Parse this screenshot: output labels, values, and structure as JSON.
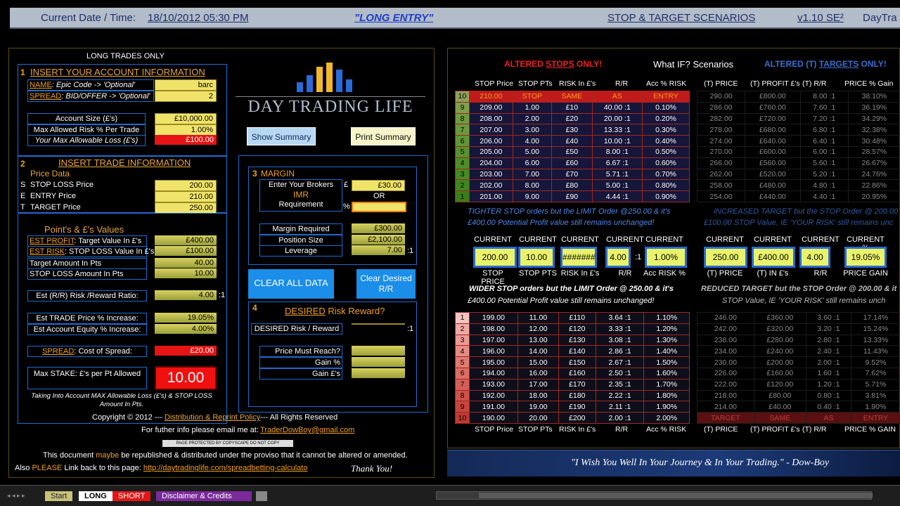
{
  "topbar": {
    "datetime_label": "Current Date / Time:",
    "datetime": "18/10/2012   05:30 PM",
    "mode": "\"LONG ENTRY\"",
    "scenarios": "STOP & TARGET SCENARIOS",
    "version": "v1.10 SE²",
    "brand": "DayTra"
  },
  "left": {
    "long_only": "LONG TRADES ONLY",
    "s1": {
      "num": "1",
      "title": "INSERT YOUR ACCOUNT INFORMATION",
      "name_label": "NAME",
      "name_hint": ": Epic Code -> 'Optional'",
      "name_val": "barc",
      "spread_label": "SPREAD",
      "spread_hint": ": BID/OFFER -> 'Optional'",
      "spread_val": "2",
      "acc_label": "Account Size (£'s)",
      "acc_val": "£10,000.00",
      "risk_label": "Max Allowed Risk % Per Trade",
      "risk_val": "1.00%",
      "loss_label": "Your Max Allowable Loss (£'s)",
      "loss_val": "£100.00"
    },
    "s2": {
      "num": "2",
      "title": "INSERT TRADE INFORMATION",
      "price_data": "Price Data",
      "s": "S",
      "e": "E",
      "t": "T",
      "stop_label": "STOP LOSS Price",
      "stop_val": "200.00",
      "entry_label": "ENTRY Price",
      "entry_val": "210.00",
      "target_label": "TARGET  Price",
      "target_val": "250.00"
    },
    "pv": {
      "title": "Point's & £'s Values",
      "profit_label": "EST PROFIT",
      "profit_hint": ": Target Value In £'s",
      "profit_val": "£400.00",
      "risk_label": "EST RISK",
      "risk_hint": ": STOP LOSS Value In £'s",
      "risk_val": "£100.00",
      "tgt_pts": "Target Amount In Pts",
      "tgt_pts_val": "40.00",
      "stop_pts": "STOP LOSS Amount In Pts",
      "stop_pts_val": "10.00",
      "rr_label": "Est (R/R) Risk /Reward Ratio:",
      "rr_val": "4.00",
      "rr_suffix": ":1",
      "tp_label": "Est TRADE Price % Increase:",
      "tp_val": "19.05%",
      "eq_label": "Est Account Equity % Increase:",
      "eq_val": "4.00%",
      "spread_label": "SPREAD",
      "spread_hint": ": Cost of Spread:",
      "spread_val": "£20.00",
      "stake_label": "Max STAKE:  £'s per Pt Allowed",
      "stake_val": "10.00",
      "note": "Taking Into Account MAX Allowable Loss (£'s) & STOP LOSS Amount In Pts."
    },
    "logo": "DAY TRADING LIFE",
    "show_summary": "Show Summary",
    "print_summary": "Print Summary",
    "s3": {
      "num": "3",
      "title": "MARGIN",
      "brokers": "Enter Your Brokers",
      "imr": "IMR",
      "req": "Requirement",
      "pound": "£",
      "pct": "%",
      "val": "£30.00",
      "or": "OR",
      "mreq_label": "Margin Required",
      "mreq_val": "£300.00",
      "pos_label": "Position Size",
      "pos_val": "£2,100.00",
      "lev_label": "Leverage",
      "lev_val": "7.00",
      "lev_suffix": ":1"
    },
    "clear_all": "CLEAR ALL DATA",
    "clear_rr": "Clear Desired R/R",
    "s4": {
      "num": "4",
      "title_a": "DESIRED",
      "title_b": " Risk Reward?",
      "rr_label": "DESIRED Risk / Reward",
      "rr_suffix": ":1",
      "reach_label": "Price Must Reach?",
      "gain_pct": "Gain %",
      "gain_gbp": "Gain £'s"
    },
    "copyright": "Copyright © 2012  ---",
    "policy": "Distribution & Reprint Policy",
    "rights": "--- All Rights Reserved",
    "info": "For futher info please email me at:",
    "email": "TraderDowBoy@gmail.com",
    "protect": "PAGE PROTECTED BY COPYSCAPE DO NOT COPY",
    "doc_a": "This document ",
    "doc_maybe": "maybe",
    "doc_b": " be republished & distributed under the proviso that it cannot be altered or amended.",
    "also": "Also ",
    "please": "PLEASE",
    "link_a": " Link back to this page: ",
    "link": "http://daytradinglife.com/spreadbetting-calculato",
    "thanks": "Thank You!"
  },
  "right": {
    "altered_stops": "ALTERED ",
    "stops_word": "STOPS",
    "only": " ONLY!",
    "whatif": "What IF? Scenarios",
    "altered_t": "ALTERED (T) ",
    "targets_word": "TARGETS",
    "only_t": " ONLY!",
    "headers": [
      "STOP Price",
      "STOP PTs",
      "RISK In £'s",
      "R/R",
      "Acc % RISK"
    ],
    "headers_t": [
      "(T) PRICE",
      "(T) PROFIT £'s",
      "(T) R/R",
      "PRICE % Gain"
    ],
    "top_rows": [
      [
        "10",
        "210.00",
        "STOP",
        "SAME",
        "AS",
        "ENTRY"
      ],
      [
        "9",
        "209.00",
        "1.00",
        "£10",
        "40.00 :1",
        "0.10%"
      ],
      [
        "8",
        "208.00",
        "2.00",
        "£20",
        "20.00 :1",
        "0.20%"
      ],
      [
        "7",
        "207.00",
        "3.00",
        "£30",
        "13.33 :1",
        "0.30%"
      ],
      [
        "6",
        "206.00",
        "4.00",
        "£40",
        "10.00 :1",
        "0.40%"
      ],
      [
        "5",
        "205.00",
        "5.00",
        "£50",
        "8.00 :1",
        "0.50%"
      ],
      [
        "4",
        "204.00",
        "6.00",
        "£60",
        "6.67 :1",
        "0.60%"
      ],
      [
        "3",
        "203.00",
        "7.00",
        "£70",
        "5.71 :1",
        "0.70%"
      ],
      [
        "2",
        "202.00",
        "8.00",
        "£80",
        "5.00 :1",
        "0.80%"
      ],
      [
        "1",
        "201.00",
        "9.00",
        "£90",
        "4.44 :1",
        "0.90%"
      ]
    ],
    "top_t_rows": [
      [
        "290.00",
        "£800.00",
        "8.00 :1",
        "38.10%"
      ],
      [
        "286.00",
        "£760.00",
        "7.60 :1",
        "36.19%"
      ],
      [
        "282.00",
        "£720.00",
        "7.20 :1",
        "34.29%"
      ],
      [
        "278.00",
        "£680.00",
        "6.80 :1",
        "32.38%"
      ],
      [
        "274.00",
        "£640.00",
        "6.40 :1",
        "30.48%"
      ],
      [
        "270.00",
        "£600.00",
        "6.00 :1",
        "28.57%"
      ],
      [
        "266.00",
        "£560.00",
        "5.60 :1",
        "26.67%"
      ],
      [
        "262.00",
        "£520.00",
        "5.20 :1",
        "24.76%"
      ],
      [
        "258.00",
        "£480.00",
        "4.80 :1",
        "22.86%"
      ],
      [
        "254.00",
        "£440.00",
        "4.40 :1",
        "20.95%"
      ]
    ],
    "tighter_1": "TIGHTER STOP orders but the LIMIT Order @250.00 & it's",
    "tighter_2": "£400.00 Potential Profit value still remains unchanged!",
    "increased_1": "INCREASED TARGET but the STOP Order @ 200.00 &",
    "increased_2": "£100.00 STOP Value, IE 'YOUR RISK' still remains unc",
    "current": "CURRENT",
    "cur_vals": [
      "200.00",
      "10.00",
      "#######",
      "4.00",
      "1.00%"
    ],
    "cur_labels": [
      "STOP PRICE",
      "STOP PTS",
      "RISK In £'s",
      "R/R",
      "Acc RISK %"
    ],
    "cur_t_vals": [
      "250.00",
      "£400.00",
      "4.00",
      "19.05%"
    ],
    "cur_t_labels": [
      "(T) PRICE",
      "(T) IN £'s",
      "R/R",
      "PRICE GAIN"
    ],
    "cur_t_head": "CURRENT %",
    "wider_1": "WIDER STOP orders but the LIMIT Order @ 250.00 & it's",
    "wider_2": "£400.00 Potential Profit value still remains unchanged!",
    "reduced_1": "REDUCED TARGET but the STOP Order @ 200.00 & it",
    "reduced_2": "STOP Value, IE 'YOUR RISK' still remains unch",
    "bot_rows": [
      [
        "1",
        "199.00",
        "11.00",
        "£110",
        "3.64 :1",
        "1.10%"
      ],
      [
        "2",
        "198.00",
        "12.00",
        "£120",
        "3.33 :1",
        "1.20%"
      ],
      [
        "3",
        "197.00",
        "13.00",
        "£130",
        "3.08 :1",
        "1.30%"
      ],
      [
        "4",
        "196.00",
        "14.00",
        "£140",
        "2.86 :1",
        "1.40%"
      ],
      [
        "5",
        "195.00",
        "15.00",
        "£150",
        "2.67 :1",
        "1.50%"
      ],
      [
        "6",
        "194.00",
        "16.00",
        "£160",
        "2.50 :1",
        "1.60%"
      ],
      [
        "7",
        "193.00",
        "17.00",
        "£170",
        "2.35 :1",
        "1.70%"
      ],
      [
        "8",
        "192.00",
        "18.00",
        "£180",
        "2.22 :1",
        "1.80%"
      ],
      [
        "9",
        "191.00",
        "19.00",
        "£190",
        "2.11 :1",
        "1.90%"
      ],
      [
        "10",
        "190.00",
        "20.00",
        "£200",
        "2.00 :1",
        "2.00%"
      ]
    ],
    "bot_t_rows": [
      [
        "246.00",
        "£360.00",
        "3.60 :1",
        "17.14%"
      ],
      [
        "242.00",
        "£320.00",
        "3.20 :1",
        "15.24%"
      ],
      [
        "238.00",
        "£280.00",
        "2.80 :1",
        "13.33%"
      ],
      [
        "234.00",
        "£240.00",
        "2.40 :1",
        "11.43%"
      ],
      [
        "230.00",
        "£200.00",
        "2.00 :1",
        "9.52%"
      ],
      [
        "226.00",
        "£160.00",
        "1.60 :1",
        "7.62%"
      ],
      [
        "222.00",
        "£120.00",
        "1.20 :1",
        "5.71%"
      ],
      [
        "218.00",
        "£80.00",
        "0.80 :1",
        "3.81%"
      ],
      [
        "214.00",
        "£40.00",
        "0.40 :1",
        "1.90%"
      ],
      [
        "TARGET",
        "SAME",
        "AS",
        "ENTRY"
      ]
    ],
    "footer_headers": [
      "STOP Price",
      "STOP PTs",
      "RISK In £'s",
      "R/R",
      "Acc % RISK"
    ],
    "footer_headers_t": [
      "(T) PRICE",
      "(T) PROFIT £'s",
      "(T) R/R",
      "PRICE % GAIN"
    ],
    "quote": "\"I Wish You Well In Your Journey & In Your Trading.\" - Dow-Boy"
  },
  "tabs": {
    "start": "Start",
    "long": "LONG",
    "short": "SHORT",
    "disclaimer": "Disclaimer & Credits"
  }
}
